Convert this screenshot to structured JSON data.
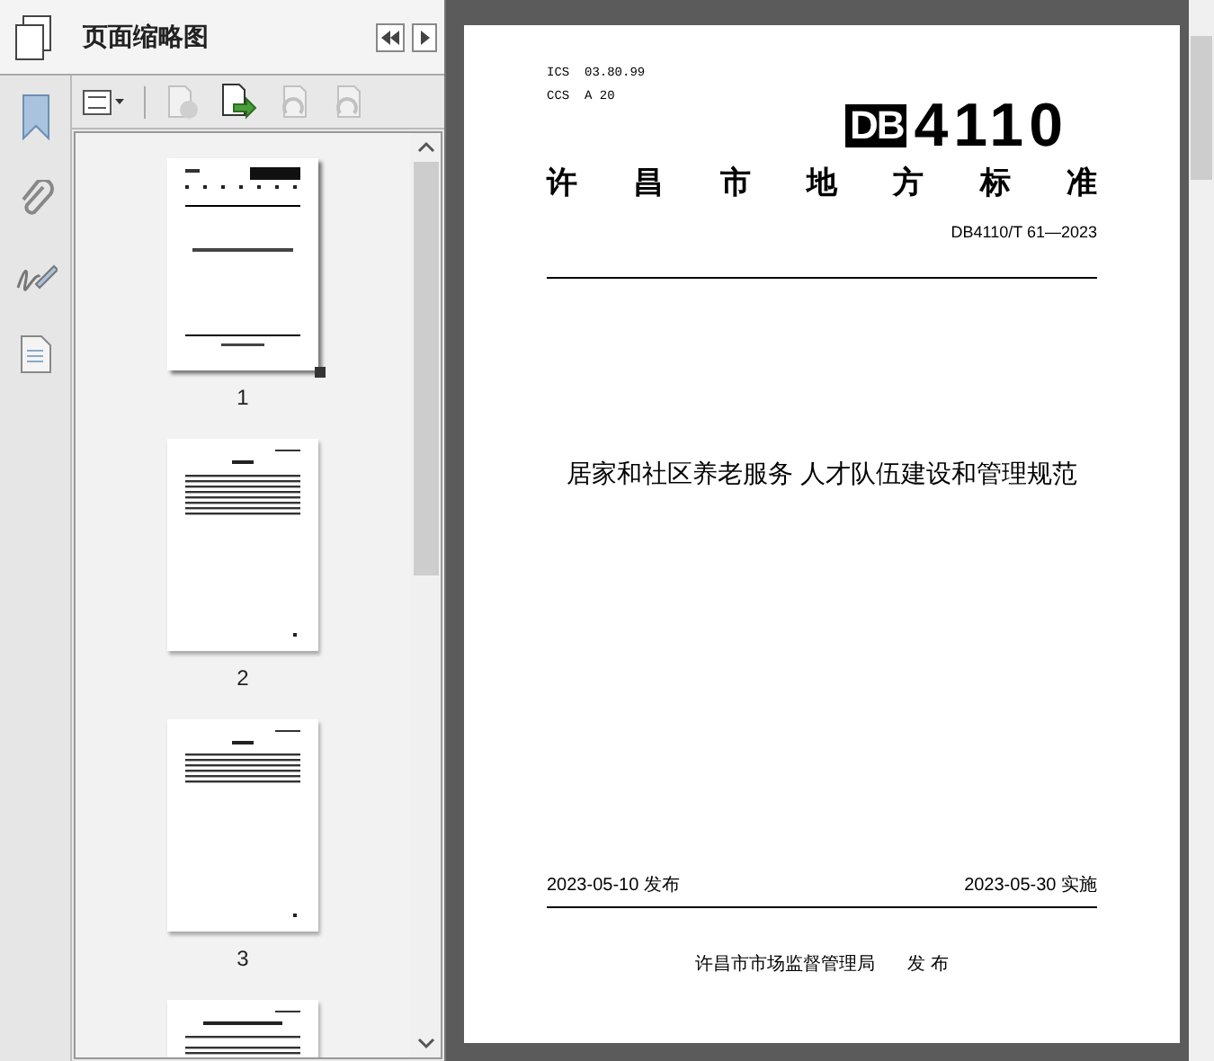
{
  "panel": {
    "title": "页面缩略图"
  },
  "thumbnails": [
    {
      "label": "1",
      "kind": "cover",
      "selected": true
    },
    {
      "label": "2",
      "kind": "toc",
      "selected": false
    },
    {
      "label": "3",
      "kind": "text",
      "selected": false
    },
    {
      "kind": "body",
      "selected": false
    }
  ],
  "document": {
    "ics": "ICS  03.80.99",
    "ccs": "CCS  A 20",
    "logo_mark": "DB",
    "logo_number": "4110",
    "category": [
      "许",
      "昌",
      "市",
      "地",
      "方",
      "标",
      "准"
    ],
    "code": "DB4110/T 61—2023",
    "title": "居家和社区养老服务 人才队伍建设和管理规范",
    "issued": "2023-05-10 发布",
    "effective": "2023-05-30 实施",
    "issuer": "许昌市市场监督管理局",
    "issuer_action": "发 布"
  }
}
